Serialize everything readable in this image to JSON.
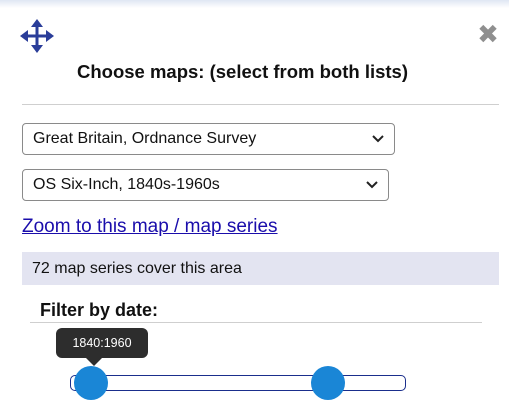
{
  "panel": {
    "title": "Choose maps: (select from both lists)",
    "icons": {
      "move": "move-arrows-icon",
      "close": "close-icon"
    },
    "close_glyph": "✖"
  },
  "map_group_select": {
    "value": "Great Britain, Ordnance Survey"
  },
  "map_series_select": {
    "value": "OS Six-Inch, 1840s-1960s"
  },
  "zoom_link": {
    "label": "Zoom to this map / map series"
  },
  "coverage": {
    "text": "72 map series cover this area"
  },
  "date_filter": {
    "label": "Filter by date:",
    "tooltip": "1840:1960",
    "min_value": 1840,
    "max_value": 1960
  },
  "colors": {
    "accent": "#1a86d6",
    "link": "#1a0dab",
    "info_bar": "#e3e4f1",
    "track_border": "#1a2e8c"
  }
}
